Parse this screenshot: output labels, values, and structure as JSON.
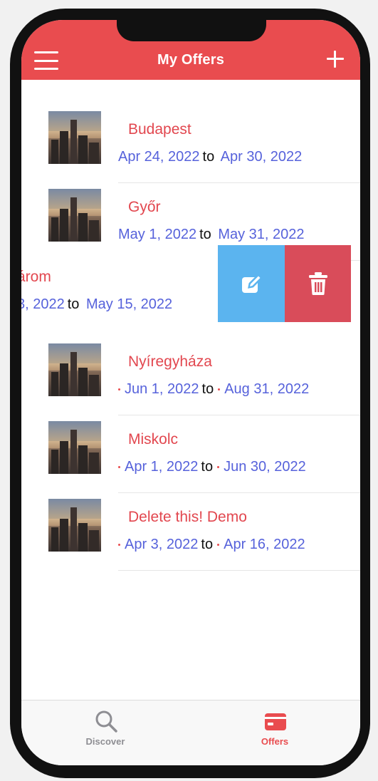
{
  "header": {
    "title": "My Offers",
    "menu_icon": "hamburger-menu-icon",
    "add_icon": "plus-icon",
    "color": "#e94c4f"
  },
  "offers": [
    {
      "title": "Budapest",
      "from": "Apr 24, 2022",
      "to_word": "to",
      "until": "Apr 30, 2022",
      "marked": false
    },
    {
      "title": "Győr",
      "from": "May 1, 2022",
      "to_word": "to",
      "until": "May 31, 2022",
      "marked": false
    },
    {
      "title": "árom",
      "from": "3, 2022",
      "to_word": "to",
      "until": "May 15, 2022",
      "marked": false,
      "swiped": true
    },
    {
      "title": "Nyíregyháza",
      "from": "Jun 1, 2022",
      "to_word": "to",
      "until": "Aug 31, 2022",
      "marked": true
    },
    {
      "title": "Miskolc",
      "from": "Apr 1, 2022",
      "to_word": "to",
      "until": "Jun 30, 2022",
      "marked": true
    },
    {
      "title": "Delete this! Demo",
      "from": "Apr 3, 2022",
      "to_word": "to",
      "until": "Apr 16, 2022",
      "marked": true
    }
  ],
  "swipe_actions": {
    "edit_icon": "edit-pencil-icon",
    "edit_color": "#5bb4ef",
    "delete_icon": "trash-icon",
    "delete_color": "#d94c5a"
  },
  "tabs": [
    {
      "label": "Discover",
      "icon": "search-icon",
      "active": false
    },
    {
      "label": "Offers",
      "icon": "card-icon",
      "active": true
    }
  ],
  "colors": {
    "title": "#e2474f",
    "date": "#5662db",
    "accent": "#e94c4f"
  }
}
